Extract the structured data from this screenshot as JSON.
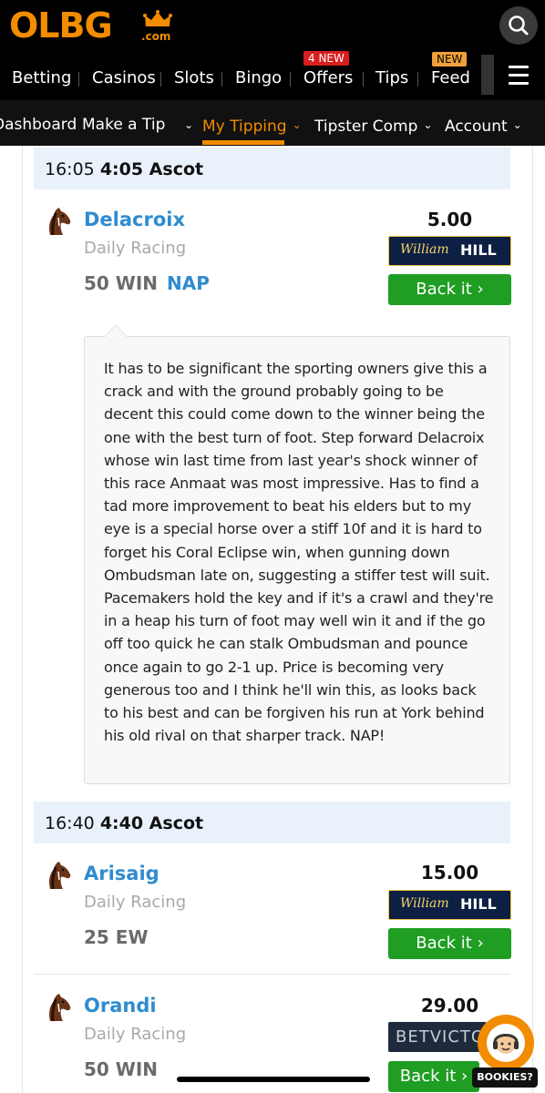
{
  "header": {
    "logo_text": "OLBG",
    "logo_suffix": ".com",
    "brand_color": "#f28c00"
  },
  "nav": {
    "items": [
      {
        "label": "Betting"
      },
      {
        "label": "Casinos"
      },
      {
        "label": "Slots"
      },
      {
        "label": "Bingo"
      },
      {
        "label": "Offers",
        "badge": "4 NEW"
      },
      {
        "label": "Tips"
      },
      {
        "label": "Feed",
        "badge": "NEW"
      }
    ]
  },
  "subnav": {
    "items": [
      {
        "label": "Dashboard"
      },
      {
        "label": "Make a Tip"
      },
      {
        "label": "My Tipping",
        "active": true
      },
      {
        "label": "Tipster Comp"
      },
      {
        "label": "Account"
      }
    ]
  },
  "races": [
    {
      "time": "16:05",
      "name": "4:05 Ascot",
      "tips": [
        {
          "horse": "Delacroix",
          "type": "Daily Racing",
          "stake": "50 WIN",
          "nap": "NAP",
          "odds": "5.00",
          "bookie": "William HILL",
          "bookie_part1": "William",
          "bookie_part2": "HILL",
          "action": "Back it",
          "comment": "It has to be significant the sporting owners give this a crack and with the ground probably going to be decent this could come down to the winner being the one with the best turn of foot. Step forward Delacroix whose win last time from last year's shock winner of this race Anmaat was most impressive. Has to find a tad more improvement to beat his elders but to my eye is a special horse over a stiff 10f and it is hard to forget his Coral Eclipse win, when gunning down Ombudsman late on, suggesting a stiffer test will suit. Pacemakers hold the key and if it's a crawl and they're in a heap his turn of foot may well win it and if the go off too quick he can stalk Ombudsman and pounce once again to go 2-1 up. Price is becoming very generous too and I think he'll win this, as looks back to his best and can be forgiven his run at York behind his old rival on that sharper track. NAP!"
        }
      ]
    },
    {
      "time": "16:40",
      "name": "4:40 Ascot",
      "tips": [
        {
          "horse": "Arisaig",
          "type": "Daily Racing",
          "stake": "25 EW",
          "odds": "15.00",
          "bookie_part1": "William",
          "bookie_part2": "HILL",
          "action": "Back it"
        },
        {
          "horse": "Orandi",
          "type": "Daily Racing",
          "stake": "50 WIN",
          "odds": "29.00",
          "bookie_part1": "BETVICTO",
          "action": "Back it"
        }
      ]
    }
  ],
  "widget": {
    "label": "BOOKIES?"
  }
}
